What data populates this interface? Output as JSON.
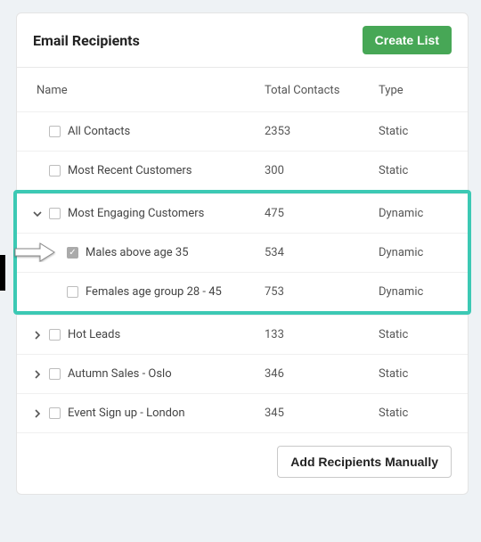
{
  "header": {
    "title": "Email Recipients",
    "create_button": "Create List"
  },
  "columns": {
    "name": "Name",
    "contacts": "Total Contacts",
    "type": "Type"
  },
  "rows": {
    "all_contacts": {
      "label": "All Contacts",
      "contacts": "2353",
      "type": "Static"
    },
    "most_recent": {
      "label": "Most Recent Customers",
      "contacts": "300",
      "type": "Static"
    },
    "most_engaging": {
      "label": "Most Engaging Customers",
      "contacts": "475",
      "type": "Dynamic"
    },
    "males_35": {
      "label": "Males above age 35",
      "contacts": "534",
      "type": "Dynamic"
    },
    "females_28_45": {
      "label": "Females age group 28 - 45",
      "contacts": "753",
      "type": "Dynamic"
    },
    "hot_leads": {
      "label": "Hot Leads",
      "contacts": "133",
      "type": "Static"
    },
    "autumn_oslo": {
      "label": "Autumn Sales - Oslo",
      "contacts": "346",
      "type": "Static"
    },
    "event_london": {
      "label": "Event Sign up - London",
      "contacts": "345",
      "type": "Static"
    }
  },
  "footer": {
    "add_manually": "Add Recipients Manually"
  }
}
